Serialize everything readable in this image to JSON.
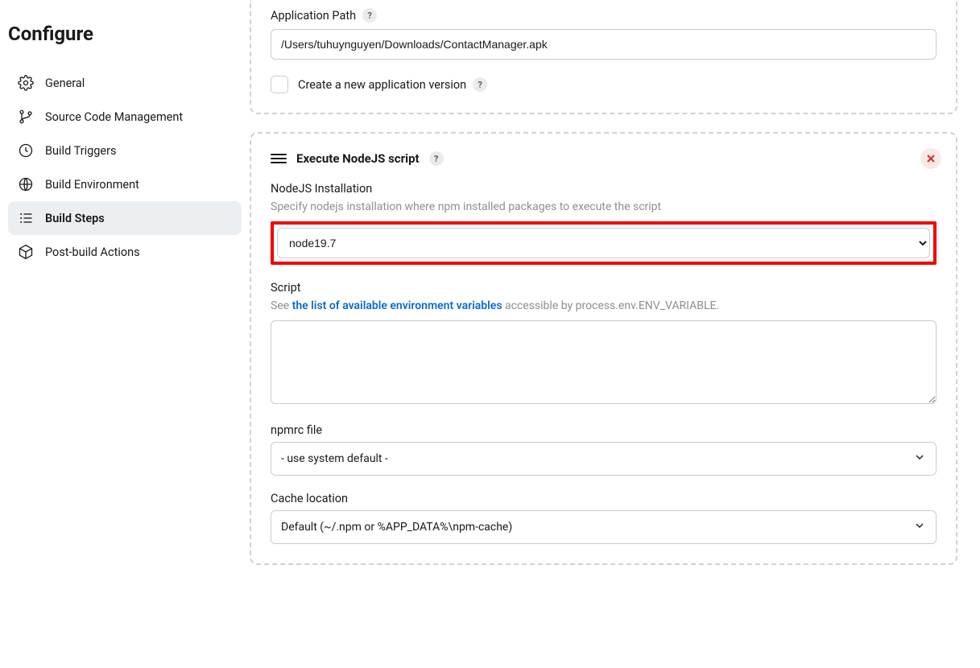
{
  "page": {
    "title": "Configure"
  },
  "sidebar": {
    "items": [
      {
        "label": "General",
        "icon": "gear-icon"
      },
      {
        "label": "Source Code Management",
        "icon": "branch-icon"
      },
      {
        "label": "Build Triggers",
        "icon": "clock-icon"
      },
      {
        "label": "Build Environment",
        "icon": "globe-icon"
      },
      {
        "label": "Build Steps",
        "icon": "steps-icon",
        "active": true
      },
      {
        "label": "Post-build Actions",
        "icon": "package-icon"
      }
    ]
  },
  "app_path_panel": {
    "label": "Application Path",
    "value": "/Users/tuhuynguyen/Downloads/ContactManager.apk",
    "checkbox_label": "Create a new application version"
  },
  "nodejs_panel": {
    "title": "Execute NodeJS script",
    "installation": {
      "label": "NodeJS Installation",
      "hint": "Specify nodejs installation where npm installed packages to execute the script",
      "value": "node19.7"
    },
    "script": {
      "label": "Script",
      "hint_prefix": "See ",
      "hint_link": "the list of available environment variables",
      "hint_suffix": " accessible by process.env.ENV_VARIABLE.",
      "value": ""
    },
    "npmrc": {
      "label": "npmrc file",
      "value": "- use system default -"
    },
    "cache": {
      "label": "Cache location",
      "value": "Default (~/.npm or %APP_DATA%\\npm-cache)"
    }
  }
}
